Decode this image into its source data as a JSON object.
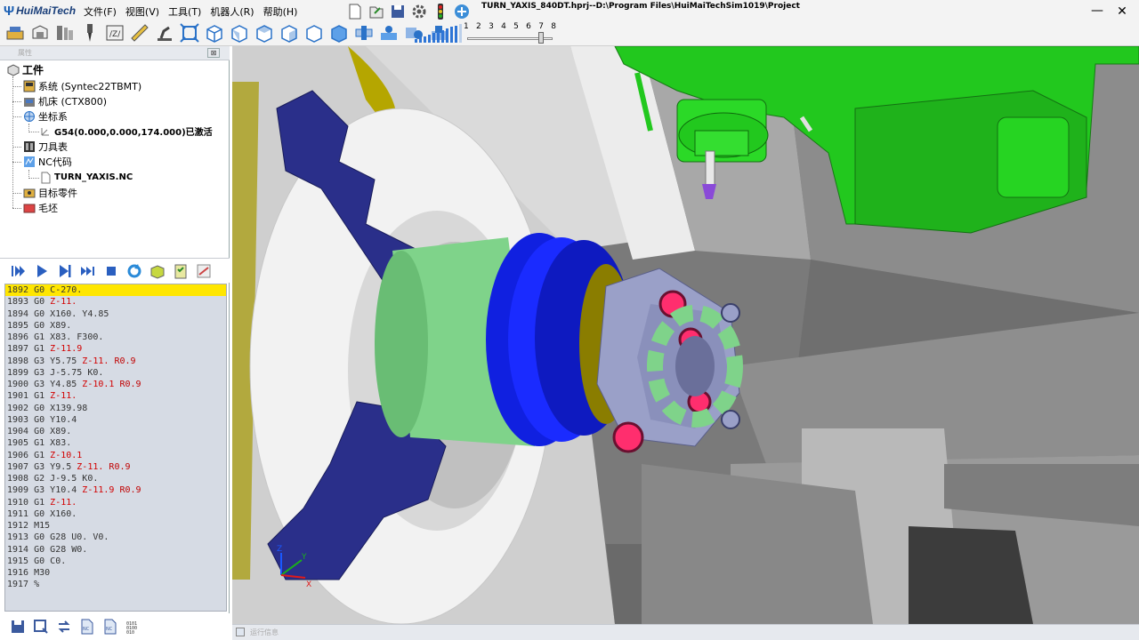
{
  "app": {
    "logo_text": "HuiMaiTech",
    "window_title": "TURN_YAXIS_840DT.hprj--D:\\Program Files\\HuiMaiTechSim1019\\Project",
    "minimize": "—",
    "close": "✕"
  },
  "menu": [
    {
      "label": "文件(F)"
    },
    {
      "label": "视图(V)"
    },
    {
      "label": "工具(T)"
    },
    {
      "label": "机器人(R)"
    },
    {
      "label": "帮助(H)"
    }
  ],
  "speed_scale": {
    "ticks": [
      "1",
      "2",
      "3",
      "4",
      "5",
      "6",
      "7",
      "8"
    ],
    "level": 7.5
  },
  "panel": {
    "title": "属性",
    "close": "⊠"
  },
  "tree": {
    "root": "工件",
    "system": "系统 (Syntec22TBMT)",
    "machine": "机床 (CTX800)",
    "coords": "坐标系",
    "g54": "G54(0.000,0.000,174.000)已激活",
    "tools": "刀具表",
    "nc": "NC代码",
    "nc_file": "TURN_YAXIS.NC",
    "target": "目标零件",
    "blank": "毛坯"
  },
  "code": {
    "current_line": "1892",
    "lines": [
      {
        "n": "1892",
        "t": [
          [
            "w",
            "G0 C-270."
          ]
        ]
      },
      {
        "n": "1893",
        "t": [
          [
            "w",
            "G0 "
          ],
          [
            "z",
            "Z-11."
          ]
        ]
      },
      {
        "n": "1894",
        "t": [
          [
            "w",
            "G0 X160. Y4.85"
          ]
        ]
      },
      {
        "n": "1895",
        "t": [
          [
            "w",
            "G0 X89."
          ]
        ]
      },
      {
        "n": "1896",
        "t": [
          [
            "w",
            "G1 X83. F300."
          ]
        ]
      },
      {
        "n": "1897",
        "t": [
          [
            "w",
            "G1 "
          ],
          [
            "z",
            "Z-11.9"
          ]
        ]
      },
      {
        "n": "1898",
        "t": [
          [
            "w",
            "G3 Y5.75 "
          ],
          [
            "z",
            "Z-11."
          ],
          [
            "w",
            " "
          ],
          [
            "k",
            "R0.9"
          ]
        ]
      },
      {
        "n": "1899",
        "t": [
          [
            "w",
            "G3 J-5.75 K0."
          ]
        ]
      },
      {
        "n": "1900",
        "t": [
          [
            "w",
            "G3 Y4.85 "
          ],
          [
            "z",
            "Z-10.1"
          ],
          [
            "w",
            " "
          ],
          [
            "k",
            "R0.9"
          ]
        ]
      },
      {
        "n": "1901",
        "t": [
          [
            "w",
            "G1 "
          ],
          [
            "z",
            "Z-11."
          ]
        ]
      },
      {
        "n": "1902",
        "t": [
          [
            "w",
            "G0 X139.98"
          ]
        ]
      },
      {
        "n": "1903",
        "t": [
          [
            "w",
            "G0 Y10.4"
          ]
        ]
      },
      {
        "n": "1904",
        "t": [
          [
            "w",
            "G0 X89."
          ]
        ]
      },
      {
        "n": "1905",
        "t": [
          [
            "w",
            "G1 X83."
          ]
        ]
      },
      {
        "n": "1906",
        "t": [
          [
            "w",
            "G1 "
          ],
          [
            "z",
            "Z-10.1"
          ]
        ]
      },
      {
        "n": "1907",
        "t": [
          [
            "w",
            "G3 Y9.5 "
          ],
          [
            "z",
            "Z-11."
          ],
          [
            "w",
            " "
          ],
          [
            "k",
            "R0.9"
          ]
        ]
      },
      {
        "n": "1908",
        "t": [
          [
            "w",
            "G2 J-9.5 K0."
          ]
        ]
      },
      {
        "n": "1909",
        "t": [
          [
            "w",
            "G3 Y10.4 "
          ],
          [
            "z",
            "Z-11.9"
          ],
          [
            "w",
            " "
          ],
          [
            "k",
            "R0.9"
          ]
        ]
      },
      {
        "n": "1910",
        "t": [
          [
            "w",
            "G1 "
          ],
          [
            "z",
            "Z-11."
          ]
        ]
      },
      {
        "n": "1911",
        "t": [
          [
            "w",
            "G0 X160."
          ]
        ]
      },
      {
        "n": "1912",
        "t": [
          [
            "w",
            "M15"
          ]
        ]
      },
      {
        "n": "1913",
        "t": [
          [
            "w",
            "G0 G28 U0. V0."
          ]
        ]
      },
      {
        "n": "1914",
        "t": [
          [
            "w",
            "G0 G28 W0."
          ]
        ]
      },
      {
        "n": "1915",
        "t": [
          [
            "w",
            "G0 C0."
          ]
        ]
      },
      {
        "n": "1916",
        "t": [
          [
            "w",
            "M30"
          ]
        ]
      },
      {
        "n": "1917",
        "t": [
          [
            "w",
            "%"
          ]
        ]
      }
    ]
  },
  "axes": {
    "x": "X",
    "y": "Y",
    "z": "Z"
  },
  "statusbar": {
    "title": "运行信息"
  },
  "colors": {
    "part_green": "#7fd38a",
    "spindle_blue": "#1020e0",
    "chuck_jaw": "#2a2f8a",
    "tool_head": "#22c81e",
    "current_line": "#ffe600"
  }
}
